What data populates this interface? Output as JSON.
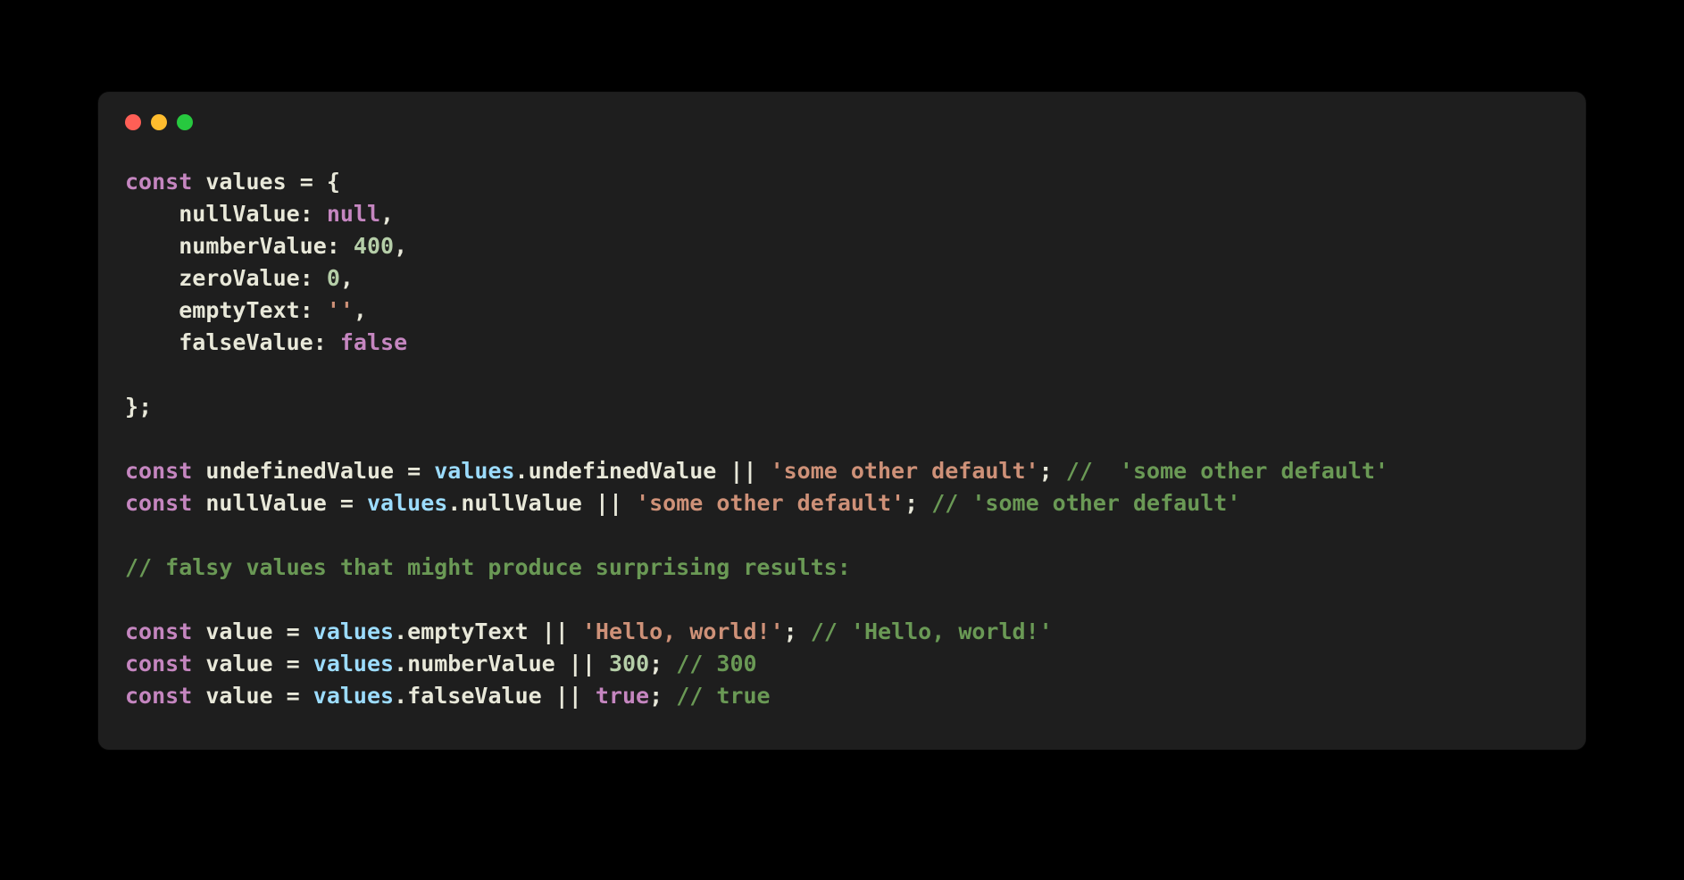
{
  "colors": {
    "bg": "#000000",
    "panel": "#1E1E1E",
    "trafficRed": "#FF5F56",
    "trafficYellow": "#FFBD2E",
    "trafficGreen": "#27C93F",
    "keyword": "#C586C0",
    "variable": "#9CDCFE",
    "string": "#CE9178",
    "number": "#B5CEA8",
    "comment": "#6A9955",
    "default": "#E8E8D9"
  },
  "code": {
    "kw_const": "const",
    "kw_null": "null",
    "kw_false": "false",
    "kw_true": "true",
    "var_values": "values",
    "prop_nullValue": "nullValue",
    "prop_numberValue": "numberValue",
    "prop_zeroValue": "zeroValue",
    "prop_emptyText": "emptyText",
    "prop_falseValue": "falseValue",
    "prop_undefinedValue": "undefinedValue",
    "num_400": "400",
    "num_0": "0",
    "num_300": "300",
    "str_empty": "''",
    "str_default": "'some other default'",
    "str_hello": "'Hello, world!'",
    "assign_undefinedValue": "undefinedValue",
    "assign_nullValue": "nullValue",
    "assign_value": "value",
    "op_eq": "=",
    "op_or": "||",
    "p_brace_open": "{",
    "p_brace_close": "}",
    "p_colon": ":",
    "p_comma": ",",
    "p_semi": ";",
    "p_dot": ".",
    "cmt_undefined": "//  'some other default'",
    "cmt_null": "// 'some other default'",
    "cmt_falsy": "// falsy values that might produce surprising results:",
    "cmt_hello": "// 'Hello, world!'",
    "cmt_300": "// 300",
    "cmt_true": "// true"
  }
}
